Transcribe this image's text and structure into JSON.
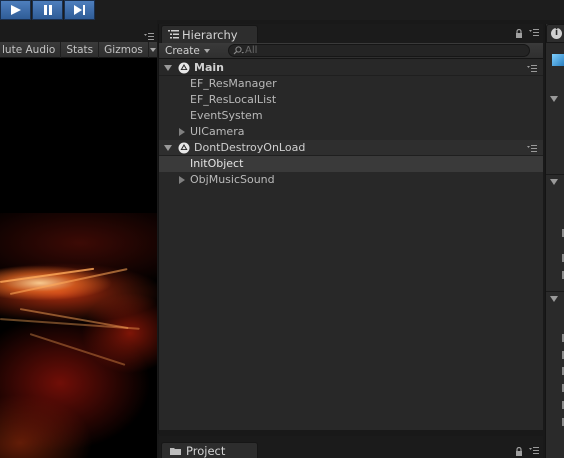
{
  "play_controls": [
    {
      "name": "play-button",
      "icon": "play-icon"
    },
    {
      "name": "pause-button",
      "icon": "pause-icon"
    },
    {
      "name": "step-button",
      "icon": "step-icon"
    }
  ],
  "game_view": {
    "toolbar": [
      "lute Audio",
      "Stats",
      "Gizmos"
    ]
  },
  "hierarchy": {
    "tab_label": "Hierarchy",
    "create_label": "Create",
    "search_placeholder": "All",
    "items": [
      {
        "label": "Main",
        "kind": "scene",
        "expanded": true
      },
      {
        "label": "EF_ResManager",
        "kind": "object",
        "indent": 1,
        "has_children": false
      },
      {
        "label": "EF_ResLocalList",
        "kind": "object",
        "indent": 1,
        "has_children": false
      },
      {
        "label": "EventSystem",
        "kind": "object",
        "indent": 1,
        "has_children": false
      },
      {
        "label": "UICamera",
        "kind": "object",
        "indent": 1,
        "has_children": true
      },
      {
        "label": "DontDestroyOnLoad",
        "kind": "scene",
        "expanded": true
      },
      {
        "label": "InitObject",
        "kind": "object",
        "indent": 1,
        "has_children": false,
        "selected": true
      },
      {
        "label": "ObjMusicSound",
        "kind": "object",
        "indent": 1,
        "has_children": true
      }
    ]
  },
  "project": {
    "tab_label": "Project"
  },
  "colors": {
    "play_accent": "#3c6eae",
    "panel_bg": "#282828",
    "selection": "#3a3a3a"
  }
}
